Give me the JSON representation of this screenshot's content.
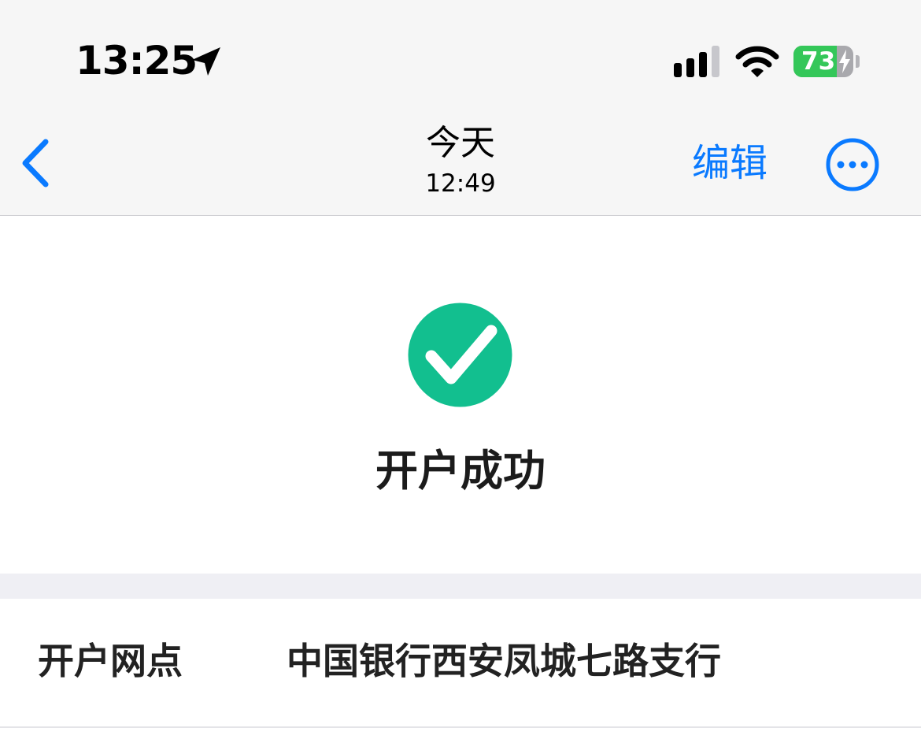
{
  "status_bar": {
    "time": "13:25",
    "location_icon": "location-arrow-icon",
    "signal_icon": "cellular-signal-icon",
    "wifi_icon": "wifi-icon",
    "battery_level": "73",
    "battery_charging": true
  },
  "nav": {
    "back_icon": "chevron-left-icon",
    "title": "今天",
    "subtitle": "12:49",
    "edit_label": "编辑",
    "more_icon": "ellipsis-circle-icon"
  },
  "result": {
    "icon": "checkmark-circle-icon",
    "text": "开户成功"
  },
  "details": [
    {
      "label": "开户网点",
      "value": "中国银行西安凤城七路支行"
    }
  ],
  "colors": {
    "accent": "#0a7aff",
    "success": "#12bf8f",
    "battery_green": "#34c759",
    "nav_background": "#f6f6f6",
    "separator_band": "#efeff4",
    "text_primary": "#222222"
  }
}
